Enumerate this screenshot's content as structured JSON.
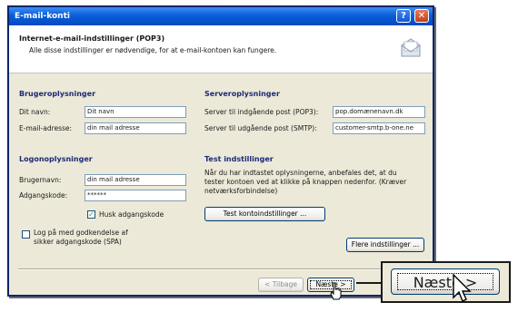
{
  "window": {
    "title": "E-mail-konti",
    "help_glyph": "?",
    "close_glyph": "✕"
  },
  "header": {
    "title": "Internet-e-mail-indstillinger (POP3)",
    "description": "Alle disse indstillinger er nødvendige, for at e-mail-kontoen kan fungere."
  },
  "user_info": {
    "section_title": "Brugeroplysninger",
    "name_label": "Dit navn:",
    "name_value": "Dit navn",
    "email_label": "E-mail-adresse:",
    "email_value": "din mail adresse"
  },
  "server_info": {
    "section_title": "Serveroplysninger",
    "incoming_label": "Server til indgående post (POP3):",
    "incoming_value": "pop.domænenavn.dk",
    "outgoing_label": "Server til udgående post (SMTP):",
    "outgoing_value": "customer-smtp.b-one.ne"
  },
  "logon_info": {
    "section_title": "Logonoplysninger",
    "username_label": "Brugernavn:",
    "username_value": "din mail adresse",
    "password_label": "Adgangskode:",
    "password_value": "******",
    "remember_label": "Husk adgangskode",
    "remember_checked": true,
    "spa_label_line1": "Log på med godkendelse af",
    "spa_label_line2": "sikker adgangskode (SPA)",
    "spa_checked": false
  },
  "test": {
    "section_title": "Test indstillinger",
    "text_line1": "Når du har indtastet oplysningerne, anbefales det, at du",
    "text_line2": "tester kontoen ved at klikke på knappen nedenfor. (Kræver",
    "text_line3": "netværksforbindelse)",
    "test_button": "Test kontoindstillinger ...",
    "more_button": "Flere indstillinger ..."
  },
  "footer": {
    "back_button": "< Tilbage",
    "next_button": "Næste >"
  },
  "zoom_callout": {
    "label": "Næste >"
  }
}
